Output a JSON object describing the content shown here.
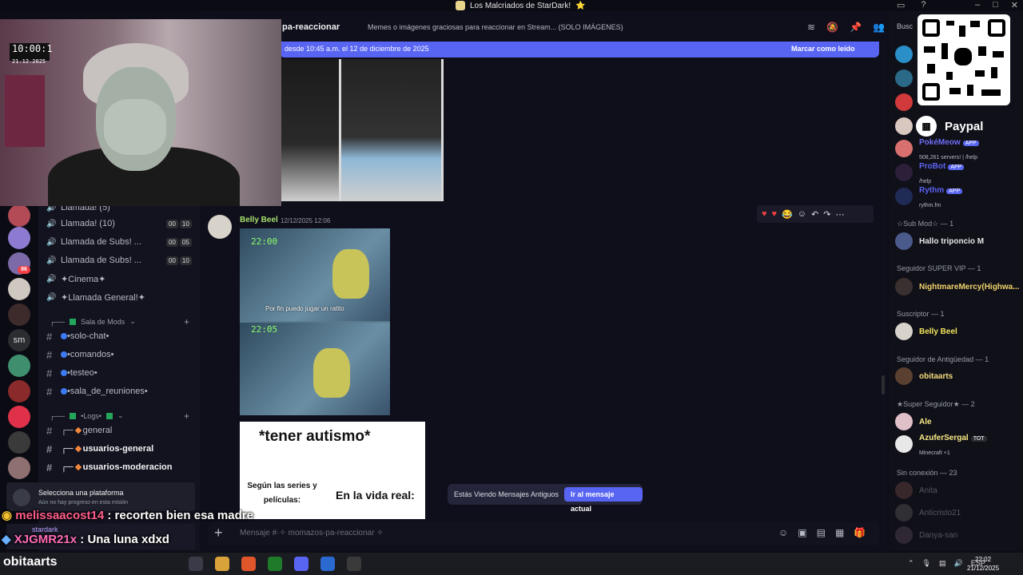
{
  "window": {
    "title": "Los Malcriados de StarDark!",
    "title_emoji": "⭐"
  },
  "header": {
    "channel_name": "pa-reaccionar",
    "topic": "Memes o imágenes graciosas para reaccionar en Stream... (SOLO IMÁGENES)",
    "members_search": "Busc"
  },
  "new_messages_bar": {
    "since": "desde 10:45 a.m. el 12 de diciembre de 2025",
    "mark_read": "Marcar como leído"
  },
  "message": {
    "author": "Belly Beel",
    "timestamp": "12/12/2025 12:06",
    "comic_times": [
      "22:00",
      "22:05"
    ],
    "comic_caption": "Por fin puedo jugar un ratito"
  },
  "meme": {
    "title": "*tener autismo*",
    "left_caption": "Según las series y películas:",
    "right_caption": "En la vida real:"
  },
  "old_messages": {
    "label": "Estás Viendo Mensajes Antiguos",
    "button": "Ir al mensaje actual"
  },
  "composer": {
    "placeholder": "Mensaje #·✧ momazos-pa-reaccionar ✧"
  },
  "channels": {
    "voice": [
      {
        "name": "Llamada! (5)",
        "a": "",
        "b": ""
      },
      {
        "name": "Llamada! (10)",
        "a": "00",
        "b": "10"
      },
      {
        "name": "Llamada de Subs! ...",
        "a": "00",
        "b": "05"
      },
      {
        "name": "Llamada de Subs! ...",
        "a": "00",
        "b": "10"
      },
      {
        "name": "✦Cinema✦"
      },
      {
        "name": "✦Llamada General!✦"
      }
    ],
    "mods_category": "Sala de Mods",
    "mods": [
      "•solo-chat•",
      "•comandos•",
      "•testeo•",
      "•sala_de_reuniones•"
    ],
    "logs_category": "•Logs•",
    "logs": [
      "general",
      "usuarios-general",
      "usuarios-moderacion"
    ]
  },
  "rail": {
    "sm_label": "sm",
    "badge": "86"
  },
  "platform": {
    "title": "Selecciona una plataforma",
    "subtitle": "Aún no hay progreso en esta misión"
  },
  "userbar": {
    "name": "stardark"
  },
  "stream_chat": [
    {
      "user": "melissaacost14",
      "sep": ":",
      "text": "recorten bien esa madre"
    },
    {
      "user": "XJGMR21x",
      "sep": ":",
      "text": "Una luna xdxd"
    }
  ],
  "members": {
    "paypal": "Paypal",
    "bots": [
      {
        "name": "PokéMeow",
        "tag": "APP",
        "sub": "508,261 servers! | /help"
      },
      {
        "name": "ProBot",
        "tag": "APP",
        "sub": "/help"
      },
      {
        "name": "Rythm",
        "tag": "APP",
        "sub": "rythm.fm"
      }
    ],
    "groups": [
      {
        "label": "☆Sub Mod☆ — 1",
        "members": [
          {
            "name": "Hallo triponcio M",
            "color": "#e6e6e6"
          }
        ]
      },
      {
        "label": "Seguidor SUPER VIP — 1",
        "members": [
          {
            "name": "NightmareMercy(Highwa...",
            "color": "#f0d36b"
          }
        ]
      },
      {
        "label": "Suscriptor — 1",
        "members": [
          {
            "name": "Belly Beel",
            "color": "#f2e45b"
          }
        ]
      },
      {
        "label": "Seguidor de Antigüedad — 1",
        "members": [
          {
            "name": "obitaarts",
            "color": "#f5dc7a"
          }
        ]
      },
      {
        "label": "★Super Seguidor★ — 2",
        "members": [
          {
            "name": "Ale",
            "color": "#f7ea84"
          },
          {
            "name": "AzuferSergal",
            "color": "#f7ea84",
            "tag": "TOT",
            "sub": "Minecraft +1"
          }
        ]
      },
      {
        "label": "Sin conexión — 23",
        "members": [
          {
            "name": "Anita",
            "color": "#6d6f78"
          },
          {
            "name": "Anticristo21",
            "color": "#6d6f78"
          },
          {
            "name": "Danya-san",
            "color": "#6d6f78"
          }
        ]
      }
    ]
  },
  "webcam": {
    "clock": "10:00:1",
    "date": "21.12.2025"
  },
  "taskbar": {
    "brand": "obitaarts",
    "lang": "ESP",
    "time": "22:02",
    "date": "21/12/2025"
  },
  "colors": {
    "accent": "#5865f2",
    "author_green": "#a7e06d",
    "online_green": "#23a55a"
  }
}
